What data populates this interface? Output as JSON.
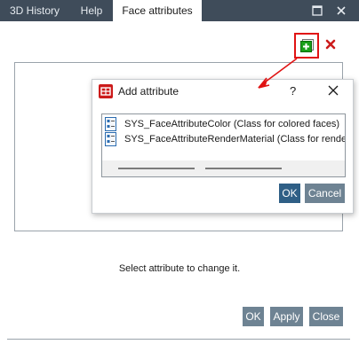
{
  "tabs": [
    {
      "label": "3D History"
    },
    {
      "label": "Help"
    },
    {
      "label": "Face attributes"
    }
  ],
  "window_controls": {
    "maximize_icon": "maximize-icon",
    "close_icon": "close-icon"
  },
  "toolbar": {
    "add_icon": "add-plus-icon",
    "delete_icon": "delete-x-icon"
  },
  "status_text": "Select attribute to change it.",
  "buttons": {
    "ok": "OK",
    "apply": "Apply",
    "close": "Close"
  },
  "dialog": {
    "title": "Add attribute",
    "help": "?",
    "items": [
      {
        "label": "SYS_FaceAttributeColor (Class for colored faces)"
      },
      {
        "label": "SYS_FaceAttributeRenderMaterial (Class for rendering material)"
      }
    ],
    "ok": "OK",
    "cancel": "Cancel"
  },
  "colors": {
    "tabbar": "#3f4c5a",
    "button": "#6e8393",
    "dialog_ok": "#2f5f86",
    "highlight": "#e01313",
    "add_icon": "#1aa01a"
  }
}
